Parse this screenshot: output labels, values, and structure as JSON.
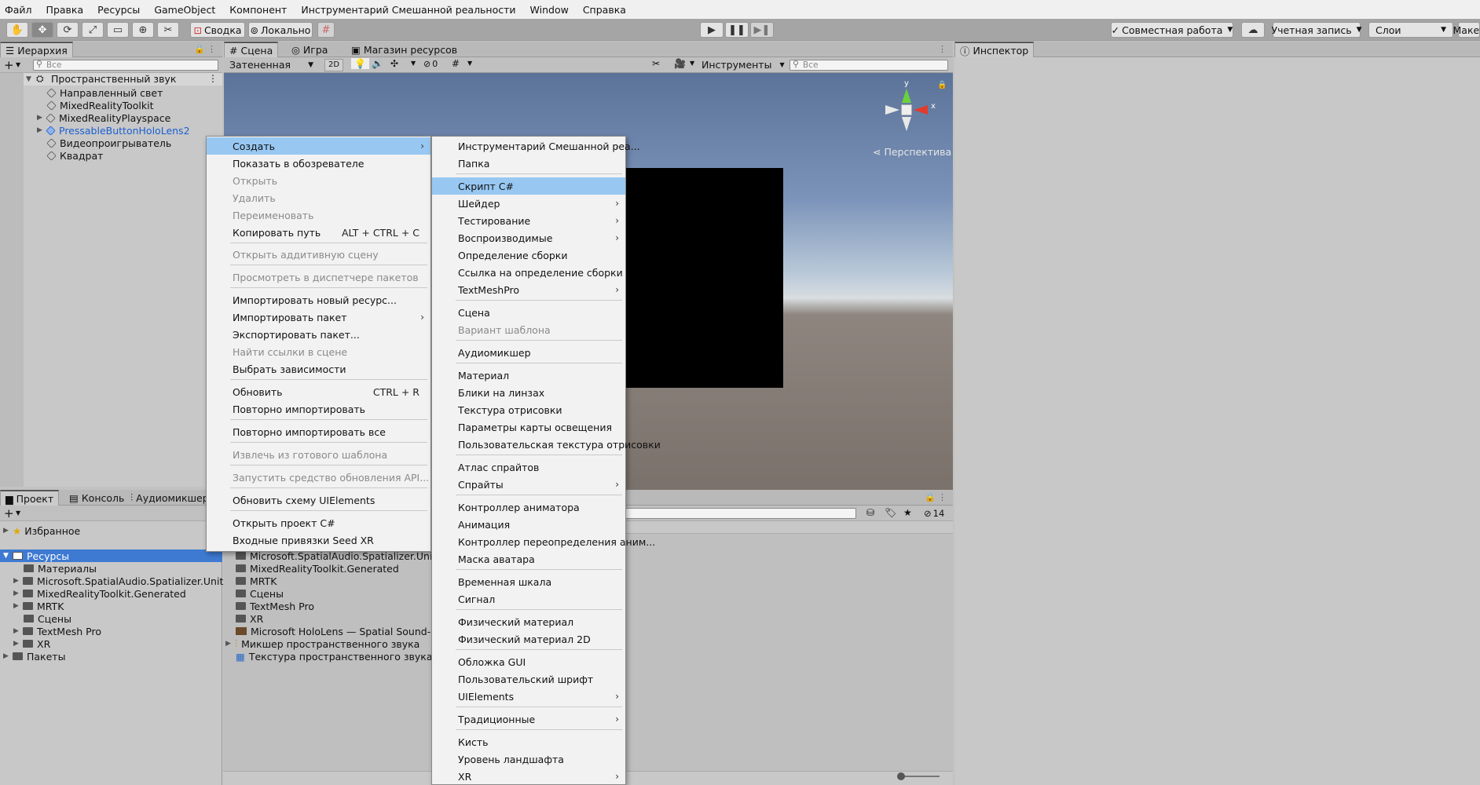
{
  "menubar": [
    "Файл",
    "Правка",
    "Ресурсы",
    "GameObject",
    "Компонент",
    "Инструментарий Смешанной реальности",
    "Window",
    "Справка"
  ],
  "toolbar": {
    "pivot_label": "Сводка",
    "local_label": "Локально",
    "collab_label": "Совместная работа",
    "account_label": "Учетная запись",
    "layers_label": "Слои",
    "layout_label": "Макет",
    "play_icon": "play-icon",
    "pause_icon": "pause-icon",
    "step_icon": "step-icon"
  },
  "hierarchy": {
    "tab_label": "Иерархия",
    "search_placeholder": "Все",
    "scene_name": "Пространственный звук",
    "items": [
      "Направленный свет",
      "MixedRealityToolkit",
      "MixedRealityPlayspace",
      "PressableButtonHoloLens2",
      "Видеопроигрыватель",
      "Квадрат"
    ]
  },
  "scene": {
    "tabs": [
      "Сцена",
      "Игра",
      "Магазин ресурсов"
    ],
    "shading_mode": "Затененная",
    "mode_2d": "2D",
    "fx_count": "0",
    "gizmos_label": "Инструменты",
    "search_placeholder": "Все",
    "perspective_label": "Перспектива",
    "axis_y": "y",
    "axis_x": "x"
  },
  "inspector": {
    "tab_label": "Инспектор"
  },
  "context_menu": {
    "items": [
      {
        "label": "Создать",
        "highlight": true,
        "submenu": true
      },
      {
        "label": "Показать в обозревателе"
      },
      {
        "label": "Открыть",
        "disabled": true
      },
      {
        "label": "Удалить",
        "disabled": true
      },
      {
        "label": "Переименовать",
        "disabled": true
      },
      {
        "label": "Копировать путь",
        "shortcut": "ALT + CTRL + C"
      },
      {
        "label": "Открыть аддитивную сцену",
        "disabled": true
      },
      {
        "label": "Просмотреть в диспетчере пакетов",
        "disabled": true
      },
      {
        "label": "Импортировать новый ресурс..."
      },
      {
        "label": "Импортировать пакет",
        "submenu": true
      },
      {
        "label": "Экспортировать пакет..."
      },
      {
        "label": "Найти ссылки в сцене",
        "disabled": true
      },
      {
        "label": "Выбрать зависимости"
      },
      {
        "label": "Обновить",
        "shortcut": "CTRL + R"
      },
      {
        "label": "Повторно импортировать"
      },
      {
        "label": "Повторно импортировать все"
      },
      {
        "label": "Извлечь из готового шаблона",
        "disabled": true
      },
      {
        "label": "Запустить средство обновления API...",
        "disabled": true
      },
      {
        "label": "Обновить схему UIElements"
      },
      {
        "label": "Открыть проект C#"
      },
      {
        "label": "Входные привязки Seed XR"
      }
    ]
  },
  "create_submenu": {
    "items": [
      {
        "label": "Инструментарий Смешанной реа...",
        "submenu": true
      },
      {
        "label": "Папка"
      },
      {
        "label": "Скрипт C#",
        "highlight": true
      },
      {
        "label": "Шейдер",
        "submenu": true
      },
      {
        "label": "Тестирование",
        "submenu": true
      },
      {
        "label": "Воспроизводимые",
        "submenu": true
      },
      {
        "label": "Определение сборки"
      },
      {
        "label": "Ссылка на определение сборки"
      },
      {
        "label": "TextMeshPro",
        "submenu": true
      },
      {
        "label": "Сцена"
      },
      {
        "label": "Вариант шаблона",
        "disabled": true
      },
      {
        "label": "Аудиомикшер"
      },
      {
        "label": "Материал"
      },
      {
        "label": "Блики на линзах"
      },
      {
        "label": "Текстура отрисовки"
      },
      {
        "label": "Параметры карты освещения"
      },
      {
        "label": "Пользовательская текстура отрисовки"
      },
      {
        "label": "Атлас спрайтов"
      },
      {
        "label": "Спрайты",
        "submenu": true
      },
      {
        "label": "Контроллер аниматора"
      },
      {
        "label": "Анимация"
      },
      {
        "label": "Контроллер переопределения аним..."
      },
      {
        "label": "Маска аватара"
      },
      {
        "label": "Временная шкала"
      },
      {
        "label": "Сигнал"
      },
      {
        "label": "Физический материал"
      },
      {
        "label": "Физический материал 2D"
      },
      {
        "label": "Обложка GUI"
      },
      {
        "label": "Пользовательский шрифт"
      },
      {
        "label": "UIElements",
        "submenu": true
      },
      {
        "label": "Традиционные",
        "submenu": true
      },
      {
        "label": "Кисть"
      },
      {
        "label": "Уровень ландшафта"
      },
      {
        "label": "XR",
        "submenu": true
      }
    ]
  },
  "project": {
    "tabs": [
      "Проект",
      "Консоль",
      "Аудиомикшер"
    ],
    "favorites_label": "Избранное",
    "assets_label": "Ресурсы",
    "packages_label": "Пакеты",
    "hidden_count": "14",
    "tree": [
      "Материалы",
      "Microsoft.SpatialAudio.Spatializer.Unity",
      "MixedRealityToolkit.Generated",
      "MRTK",
      "Сцены",
      "TextMesh Pro",
      "XR"
    ],
    "content": [
      "Microsoft.SpatialAudio.Spatializer.Unity",
      "MixedRealityToolkit.Generated",
      "MRTK",
      "Сцены",
      "TextMesh Pro",
      "XR",
      "Microsoft HoloLens — Spatial Sound-PT",
      "Микшер пространственного звука",
      "Текстура пространственного звука"
    ]
  },
  "colors": {
    "highlight": "#98c8f2",
    "selection": "#3e7ad2",
    "link_blue": "#1b5fd1"
  }
}
